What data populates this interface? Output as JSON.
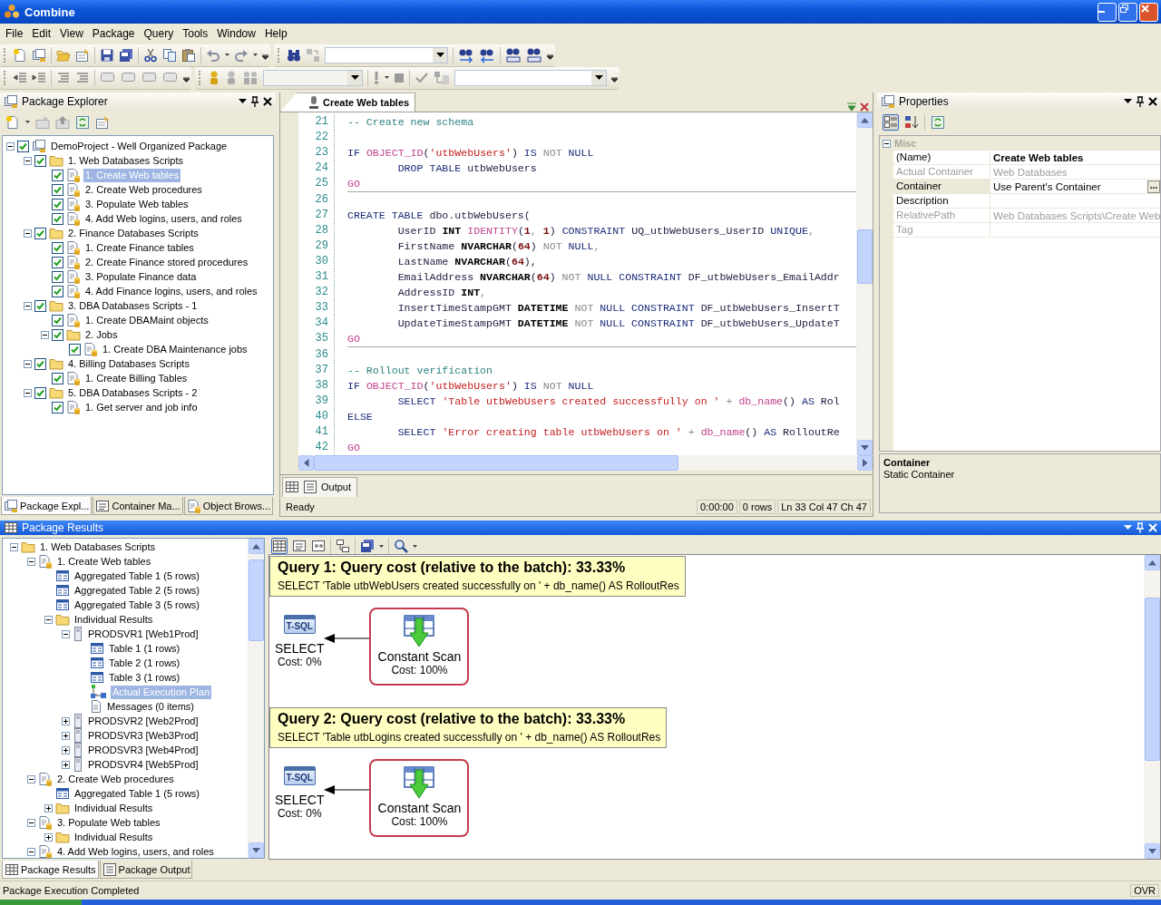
{
  "window": {
    "title": "Combine"
  },
  "menu": [
    "File",
    "Edit",
    "View",
    "Package",
    "Query",
    "Tools",
    "Window",
    "Help"
  ],
  "package_explorer": {
    "title": "Package Explorer",
    "tree": [
      {
        "label": "DemoProject - Well Organized Package",
        "kind": "project",
        "checked": true,
        "expanded": true,
        "selected": false,
        "children": [
          {
            "label": "1. Web Databases Scripts",
            "kind": "folder",
            "checked": true,
            "expanded": true,
            "selected": false,
            "children": [
              {
                "label": "1. Create Web tables",
                "kind": "script",
                "checked": true,
                "selected": true
              },
              {
                "label": "2. Create Web procedures",
                "kind": "script",
                "checked": true,
                "selected": false
              },
              {
                "label": "3. Populate Web tables",
                "kind": "script",
                "checked": true,
                "selected": false
              },
              {
                "label": "4. Add Web logins, users, and roles",
                "kind": "script",
                "checked": true,
                "selected": false
              }
            ]
          },
          {
            "label": "2. Finance Databases Scripts",
            "kind": "folder",
            "checked": true,
            "expanded": true,
            "selected": false,
            "children": [
              {
                "label": "1. Create Finance tables",
                "kind": "script",
                "checked": true,
                "selected": false
              },
              {
                "label": "2. Create Finance stored procedures",
                "kind": "script",
                "checked": true,
                "selected": false
              },
              {
                "label": "3. Populate Finance data",
                "kind": "script",
                "checked": true,
                "selected": false
              },
              {
                "label": "4. Add Finance logins, users, and roles",
                "kind": "script",
                "checked": true,
                "selected": false
              }
            ]
          },
          {
            "label": "3. DBA Databases Scripts - 1",
            "kind": "folder",
            "checked": true,
            "expanded": true,
            "selected": false,
            "children": [
              {
                "label": "1. Create DBAMaint objects",
                "kind": "script",
                "checked": true,
                "selected": false
              },
              {
                "label": "2. Jobs",
                "kind": "folder",
                "checked": true,
                "expanded": true,
                "selected": false,
                "children": [
                  {
                    "label": "1. Create DBA Maintenance jobs",
                    "kind": "script",
                    "checked": true,
                    "selected": false
                  }
                ]
              }
            ]
          },
          {
            "label": "4. Billing Databases Scripts",
            "kind": "folder",
            "checked": true,
            "expanded": true,
            "selected": false,
            "children": [
              {
                "label": "1. Create Billing Tables",
                "kind": "script",
                "checked": true,
                "selected": false
              }
            ]
          },
          {
            "label": "5. DBA Databases Scripts - 2",
            "kind": "folder",
            "checked": true,
            "expanded": true,
            "selected": false,
            "children": [
              {
                "label": "1. Get server and job info",
                "kind": "script",
                "checked": true,
                "selected": false
              }
            ]
          }
        ]
      }
    ],
    "tabs": [
      {
        "label": "Package Expl...",
        "kind": "explorer",
        "selected": true
      },
      {
        "label": "Container Ma...",
        "kind": "container",
        "selected": false
      },
      {
        "label": "Object Brows...",
        "kind": "browser",
        "selected": false
      }
    ]
  },
  "editor": {
    "tab": {
      "label": "Create Web tables",
      "selected": true
    },
    "blocks": [
      {
        "lines": [
          {
            "num": "21",
            "tokens": [
              {
                "text": "-- Create new schema",
                "kind": "comment"
              }
            ]
          },
          {
            "num": "22"
          },
          {
            "num": "23",
            "tokens": [
              {
                "text": "IF ",
                "kind": "keyword"
              },
              {
                "text": "OBJECT_ID",
                "kind": "function"
              },
              {
                "text": "(",
                "kind": "plain"
              },
              {
                "text": "'utbWebUsers'",
                "kind": "string"
              },
              {
                "text": ") ",
                "kind": "plain"
              },
              {
                "text": "IS ",
                "kind": "keyword"
              },
              {
                "text": "NOT ",
                "kind": "operator"
              },
              {
                "text": "NULL",
                "kind": "keyword"
              }
            ]
          },
          {
            "num": "24",
            "tokens": [
              {
                "text": "        DROP TABLE ",
                "kind": "keyword"
              },
              {
                "text": "utbWebUsers",
                "kind": "plain"
              }
            ]
          },
          {
            "num": "25",
            "tokens": [
              {
                "text": "GO",
                "kind": "function"
              }
            ]
          }
        ]
      },
      {
        "lines": [
          {
            "num": "26"
          },
          {
            "num": "27",
            "tokens": [
              {
                "text": "CREATE TABLE ",
                "kind": "keyword"
              },
              {
                "text": "dbo.utbWebUsers(",
                "kind": "plain"
              }
            ]
          },
          {
            "num": "28",
            "tokens": [
              {
                "text": "        UserID ",
                "kind": "plain"
              },
              {
                "text": "INT ",
                "kind": "type"
              },
              {
                "text": "IDENTITY",
                "kind": "function"
              },
              {
                "text": "(",
                "kind": "plain"
              },
              {
                "text": "1",
                "kind": "number"
              },
              {
                "text": ", ",
                "kind": "operator"
              },
              {
                "text": "1",
                "kind": "number"
              },
              {
                "text": ") ",
                "kind": "plain"
              },
              {
                "text": "CONSTRAINT ",
                "kind": "keyword"
              },
              {
                "text": "UQ_utbWebUsers_UserID ",
                "kind": "plain"
              },
              {
                "text": "UNIQUE",
                "kind": "keyword"
              },
              {
                "text": ",",
                "kind": "operator"
              }
            ]
          },
          {
            "num": "29",
            "tokens": [
              {
                "text": "        FirstName ",
                "kind": "plain"
              },
              {
                "text": "NVARCHAR",
                "kind": "type"
              },
              {
                "text": "(",
                "kind": "plain"
              },
              {
                "text": "64",
                "kind": "number"
              },
              {
                "text": ") ",
                "kind": "plain"
              },
              {
                "text": "NOT ",
                "kind": "operator"
              },
              {
                "text": "NULL",
                "kind": "keyword"
              },
              {
                "text": ",",
                "kind": "operator"
              }
            ]
          },
          {
            "num": "30",
            "tokens": [
              {
                "text": "        LastName ",
                "kind": "plain"
              },
              {
                "text": "NVARCHAR",
                "kind": "type"
              },
              {
                "text": "(",
                "kind": "plain"
              },
              {
                "text": "64",
                "kind": "number"
              },
              {
                "text": "),",
                "kind": "plain"
              }
            ]
          },
          {
            "num": "31",
            "tokens": [
              {
                "text": "        EmailAddress ",
                "kind": "plain"
              },
              {
                "text": "NVARCHAR",
                "kind": "type"
              },
              {
                "text": "(",
                "kind": "plain"
              },
              {
                "text": "64",
                "kind": "number"
              },
              {
                "text": ") ",
                "kind": "plain"
              },
              {
                "text": "NOT ",
                "kind": "operator"
              },
              {
                "text": "NULL CONSTRAINT ",
                "kind": "keyword"
              },
              {
                "text": "DF_utbWebUsers_EmailAddr",
                "kind": "plain"
              }
            ]
          },
          {
            "num": "32",
            "tokens": [
              {
                "text": "        AddressID ",
                "kind": "plain"
              },
              {
                "text": "INT",
                "kind": "type"
              },
              {
                "text": ",",
                "kind": "operator"
              }
            ]
          },
          {
            "num": "33",
            "tokens": [
              {
                "text": "        InsertTimeStampGMT ",
                "kind": "plain"
              },
              {
                "text": "DATETIME ",
                "kind": "type"
              },
              {
                "text": "NOT ",
                "kind": "operator"
              },
              {
                "text": "NULL CONSTRAINT ",
                "kind": "keyword"
              },
              {
                "text": "DF_utbWebUsers_InsertT",
                "kind": "plain"
              }
            ]
          },
          {
            "num": "34",
            "tokens": [
              {
                "text": "        UpdateTimeStampGMT ",
                "kind": "plain"
              },
              {
                "text": "DATETIME ",
                "kind": "type"
              },
              {
                "text": "NOT ",
                "kind": "operator"
              },
              {
                "text": "NULL CONSTRAINT ",
                "kind": "keyword"
              },
              {
                "text": "DF_utbWebUsers_UpdateT",
                "kind": "plain"
              }
            ]
          },
          {
            "num": "35",
            "tokens": [
              {
                "text": "GO",
                "kind": "function"
              }
            ]
          }
        ]
      },
      {
        "lines": [
          {
            "num": "36"
          },
          {
            "num": "37",
            "tokens": [
              {
                "text": "-- Rollout verification",
                "kind": "comment"
              }
            ]
          },
          {
            "num": "38",
            "tokens": [
              {
                "text": "IF ",
                "kind": "keyword"
              },
              {
                "text": "OBJECT_ID",
                "kind": "function"
              },
              {
                "text": "(",
                "kind": "plain"
              },
              {
                "text": "'utbWebUsers'",
                "kind": "string"
              },
              {
                "text": ") ",
                "kind": "plain"
              },
              {
                "text": "IS ",
                "kind": "keyword"
              },
              {
                "text": "NOT ",
                "kind": "operator"
              },
              {
                "text": "NULL",
                "kind": "keyword"
              }
            ]
          },
          {
            "num": "39",
            "tokens": [
              {
                "text": "        SELECT ",
                "kind": "keyword"
              },
              {
                "text": "'Table utbWebUsers created successfully on '",
                "kind": "string"
              },
              {
                "text": " + ",
                "kind": "operator"
              },
              {
                "text": "db_name",
                "kind": "function"
              },
              {
                "text": "() ",
                "kind": "plain"
              },
              {
                "text": "AS ",
                "kind": "keyword"
              },
              {
                "text": "Rol",
                "kind": "plain"
              }
            ]
          },
          {
            "num": "40",
            "tokens": [
              {
                "text": "ELSE",
                "kind": "keyword"
              }
            ]
          },
          {
            "num": "41",
            "tokens": [
              {
                "text": "        SELECT ",
                "kind": "keyword"
              },
              {
                "text": "'Error creating table utbWebUsers on '",
                "kind": "string"
              },
              {
                "text": " + ",
                "kind": "operator"
              },
              {
                "text": "db_name",
                "kind": "function"
              },
              {
                "text": "() ",
                "kind": "plain"
              },
              {
                "text": "AS ",
                "kind": "keyword"
              },
              {
                "text": "RolloutRe",
                "kind": "plain"
              }
            ]
          },
          {
            "num": "42",
            "tokens": [
              {
                "text": "GO",
                "kind": "function"
              }
            ]
          }
        ]
      }
    ],
    "bottom_tab": "Output",
    "status": {
      "message": "Ready",
      "cells": [
        "0:00:00",
        "0 rows",
        "Ln 33 Col 47 Ch 47"
      ]
    }
  },
  "properties": {
    "title": "Properties",
    "category": {
      "name": "Misc",
      "expanded": true
    },
    "rows": [
      {
        "name": "(Name)",
        "value": "Create Web tables",
        "bold": true,
        "readonly": false,
        "selected": false
      },
      {
        "name": "Actual Container",
        "value": "Web Databases",
        "bold": false,
        "readonly": true,
        "selected": false
      },
      {
        "name": "Container",
        "value": "Use Parent's Container",
        "bold": false,
        "readonly": false,
        "selected": true,
        "button": "..."
      },
      {
        "name": "Description",
        "readonly": false,
        "selected": false
      },
      {
        "name": "RelativePath",
        "value": "Web Databases Scripts\\Create Web",
        "bold": false,
        "readonly": true,
        "selected": false
      },
      {
        "name": "Tag",
        "readonly": true,
        "selected": false
      }
    ],
    "help": {
      "title": "Container",
      "text": "Static Container"
    }
  },
  "package_results": {
    "title": "Package Results",
    "tree": [
      {
        "label": "1. Web Databases Scripts",
        "kind": "folder",
        "expanded": true,
        "selected": false,
        "children": [
          {
            "label": "1. Create Web tables",
            "kind": "script",
            "expanded": true,
            "selected": false,
            "children": [
              {
                "label": "Aggregated Table 1 (5 rows)",
                "kind": "table",
                "selected": false
              },
              {
                "label": "Aggregated Table 2 (5 rows)",
                "kind": "table",
                "selected": false
              },
              {
                "label": "Aggregated Table 3 (5 rows)",
                "kind": "table",
                "selected": false
              },
              {
                "label": "Individual Results",
                "kind": "folder",
                "expanded": true,
                "selected": false,
                "children": [
                  {
                    "label": "PRODSVR1 [Web1Prod]",
                    "kind": "server",
                    "expanded": true,
                    "selected": false,
                    "children": [
                      {
                        "label": "Table 1 (1 rows)",
                        "kind": "table",
                        "selected": false
                      },
                      {
                        "label": "Table 2 (1 rows)",
                        "kind": "table",
                        "selected": false
                      },
                      {
                        "label": "Table 3 (1 rows)",
                        "kind": "table",
                        "selected": false
                      },
                      {
                        "label": "Actual Execution Plan",
                        "kind": "plan",
                        "selected": true
                      },
                      {
                        "label": "Messages (0 items)",
                        "kind": "messages",
                        "selected": false
                      }
                    ]
                  },
                  {
                    "label": "PRODSVR2 [Web2Prod]",
                    "kind": "server",
                    "expanded": false,
                    "selected": false
                  },
                  {
                    "label": "PRODSVR3 [Web3Prod]",
                    "kind": "server",
                    "expanded": false,
                    "selected": false
                  },
                  {
                    "label": "PRODSVR3 [Web4Prod]",
                    "kind": "server",
                    "expanded": false,
                    "selected": false
                  },
                  {
                    "label": "PRODSVR4 [Web5Prod]",
                    "kind": "server",
                    "expanded": false,
                    "selected": false
                  }
                ]
              }
            ]
          },
          {
            "label": "2. Create Web procedures",
            "kind": "script",
            "expanded": true,
            "selected": false,
            "children": [
              {
                "label": "Aggregated Table 1 (5 rows)",
                "kind": "table",
                "selected": false
              },
              {
                "label": "Individual Results",
                "kind": "folder",
                "expanded": false,
                "selected": false
              }
            ]
          },
          {
            "label": "3. Populate Web tables",
            "kind": "script",
            "expanded": true,
            "selected": false,
            "children": [
              {
                "label": "Individual Results",
                "kind": "folder",
                "expanded": false,
                "selected": false
              }
            ]
          },
          {
            "label": "4. Add Web logins, users, and roles",
            "kind": "script",
            "expanded": true,
            "selected": false
          }
        ]
      }
    ],
    "queries": [
      {
        "title": "Query 1: Query cost (relative to the batch): 33.33%",
        "sql": "SELECT 'Table utbWebUsers created successfully on ' + db_name() AS RolloutRes",
        "operators": [
          {
            "kind": "tsql",
            "icon_label": "T-SQL",
            "name": "SELECT",
            "cost": "Cost: 0%",
            "highlighted": false
          },
          {
            "kind": "scan",
            "name": "Constant Scan",
            "cost": "Cost: 100%",
            "highlighted": true
          }
        ]
      },
      {
        "title": "Query 2: Query cost (relative to the batch): 33.33%",
        "sql": "SELECT 'Table utbLogins created successfully on ' + db_name() AS RolloutRes",
        "operators": [
          {
            "kind": "tsql",
            "icon_label": "T-SQL",
            "name": "SELECT",
            "cost": "Cost: 0%",
            "highlighted": false
          },
          {
            "kind": "scan",
            "name": "Constant Scan",
            "cost": "Cost: 100%",
            "highlighted": true
          }
        ]
      }
    ],
    "tabs": [
      {
        "label": "Package Results",
        "kind": "results",
        "selected": true
      },
      {
        "label": "Package Output",
        "kind": "output",
        "selected": false
      }
    ]
  },
  "status_bar": {
    "message": "Package Execution Completed",
    "mode": "OVR"
  }
}
